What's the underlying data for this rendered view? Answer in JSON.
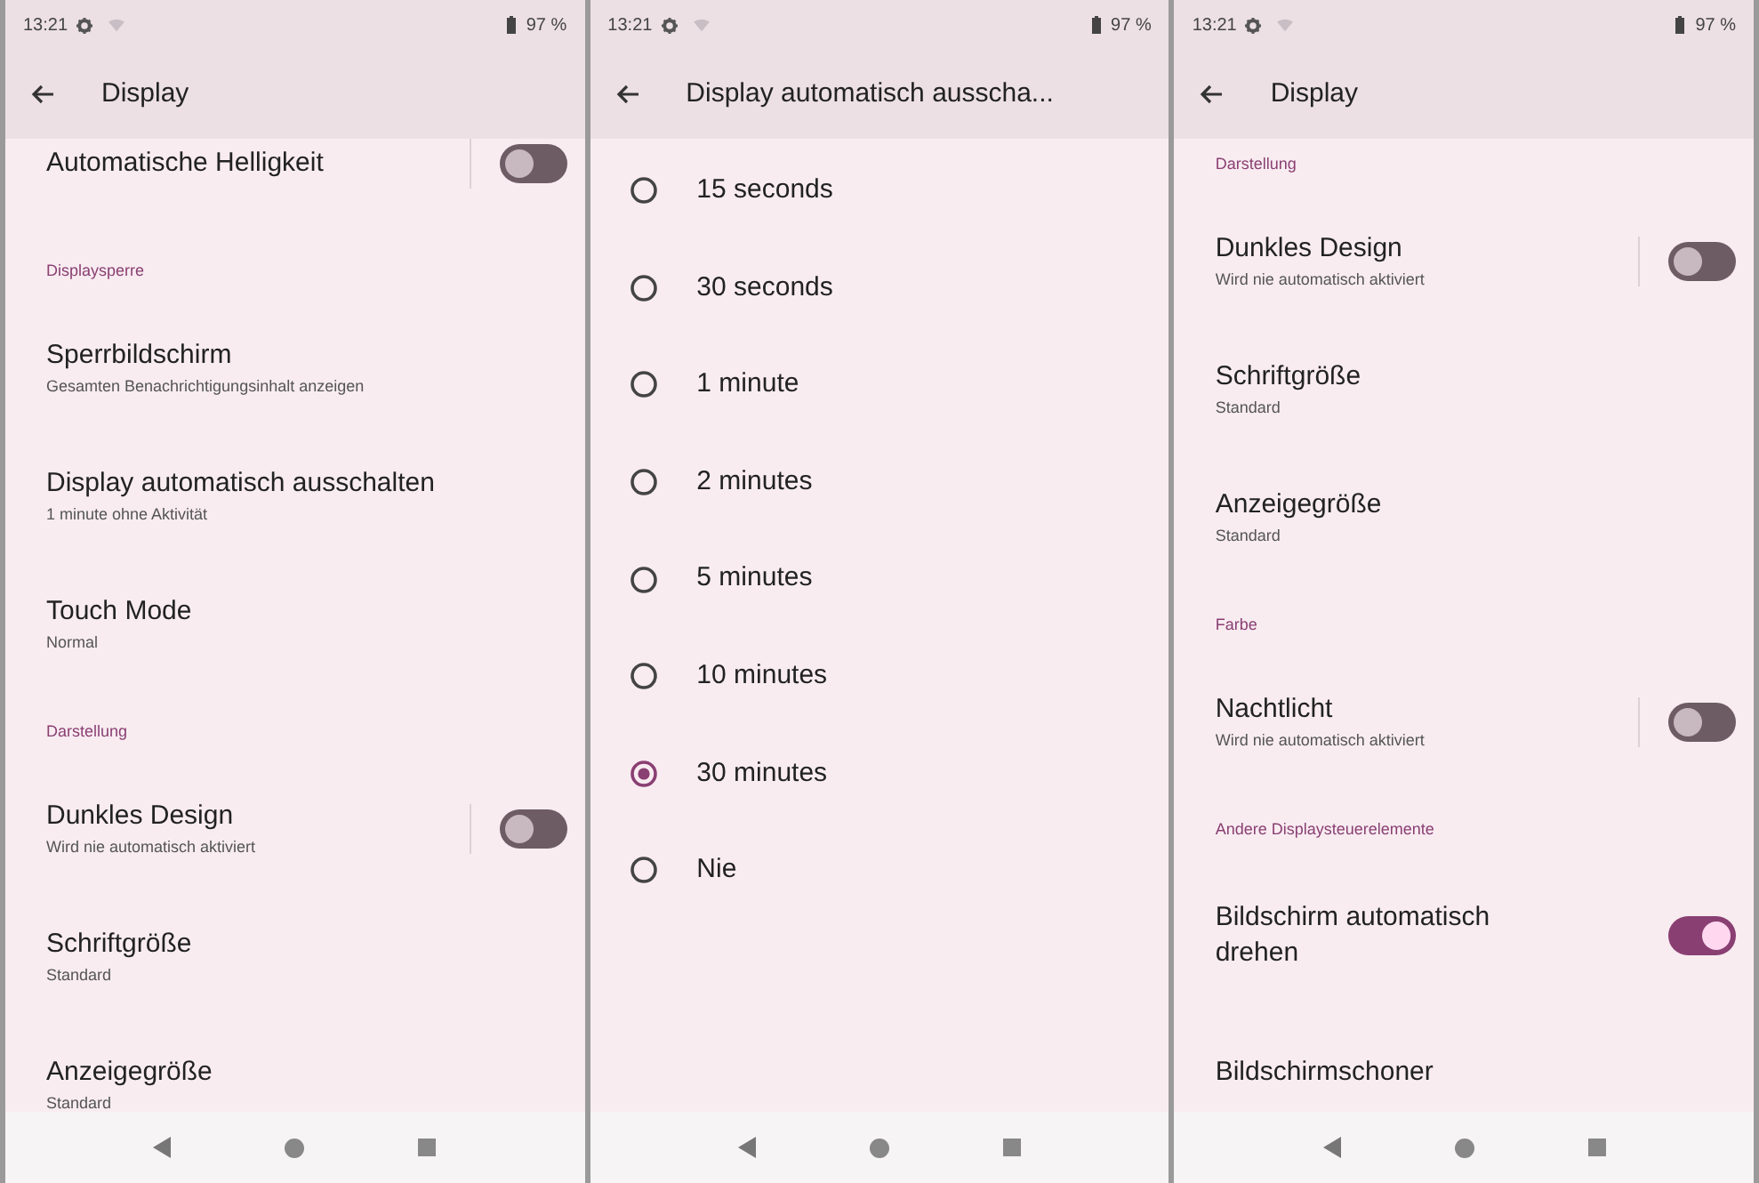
{
  "screens": [
    {
      "status_bar": {
        "time": "13:21",
        "battery": "97 %"
      },
      "title": "Display",
      "items": [
        {
          "kind": "toggle",
          "title": "Automatische Helligkeit",
          "on": false
        },
        {
          "kind": "header",
          "title": "Displaysperre"
        },
        {
          "kind": "setting",
          "title": "Sperrbildschirm",
          "subtitle": "Gesamten Benachrichtigungsinhalt anzeigen"
        },
        {
          "kind": "setting",
          "title": "Display automatisch ausschalten",
          "subtitle": "1 minute ohne Aktivität"
        },
        {
          "kind": "setting",
          "title": "Touch Mode",
          "subtitle": "Normal"
        },
        {
          "kind": "header",
          "title": "Darstellung"
        },
        {
          "kind": "toggle",
          "title": "Dunkles Design",
          "subtitle": "Wird nie automatisch aktiviert",
          "on": false
        },
        {
          "kind": "setting",
          "title": "Schriftgröße",
          "subtitle": "Standard"
        },
        {
          "kind": "setting",
          "title": "Anzeigegröße",
          "subtitle": "Standard"
        }
      ]
    },
    {
      "status_bar": {
        "time": "13:21",
        "battery": "97 %"
      },
      "title": "Display automatisch ausscha...",
      "items": [
        {
          "kind": "radio",
          "title": "15 seconds",
          "selected": false
        },
        {
          "kind": "radio",
          "title": "30 seconds",
          "selected": false
        },
        {
          "kind": "radio",
          "title": "1 minute",
          "selected": false
        },
        {
          "kind": "radio",
          "title": "2 minutes",
          "selected": false
        },
        {
          "kind": "radio",
          "title": "5 minutes",
          "selected": false
        },
        {
          "kind": "radio",
          "title": "10 minutes",
          "selected": false
        },
        {
          "kind": "radio",
          "title": "30 minutes",
          "selected": true
        },
        {
          "kind": "radio",
          "title": "Nie",
          "selected": false
        }
      ]
    },
    {
      "status_bar": {
        "time": "13:21",
        "battery": "97 %"
      },
      "title": "Display",
      "items": [
        {
          "kind": "header",
          "title": "Darstellung"
        },
        {
          "kind": "toggle",
          "title": "Dunkles Design",
          "subtitle": "Wird nie automatisch aktiviert",
          "on": false
        },
        {
          "kind": "setting",
          "title": "Schriftgröße",
          "subtitle": "Standard"
        },
        {
          "kind": "setting",
          "title": "Anzeigegröße",
          "subtitle": "Standard"
        },
        {
          "kind": "header",
          "title": "Farbe"
        },
        {
          "kind": "toggle",
          "title": "Nachtlicht",
          "subtitle": "Wird nie automatisch aktiviert",
          "on": false
        },
        {
          "kind": "header",
          "title": "Andere Displaysteuerelemente"
        },
        {
          "kind": "toggle",
          "title": "Bildschirm automatisch drehen",
          "on": true
        },
        {
          "kind": "setting",
          "title": "Bildschirmschoner"
        }
      ]
    }
  ]
}
